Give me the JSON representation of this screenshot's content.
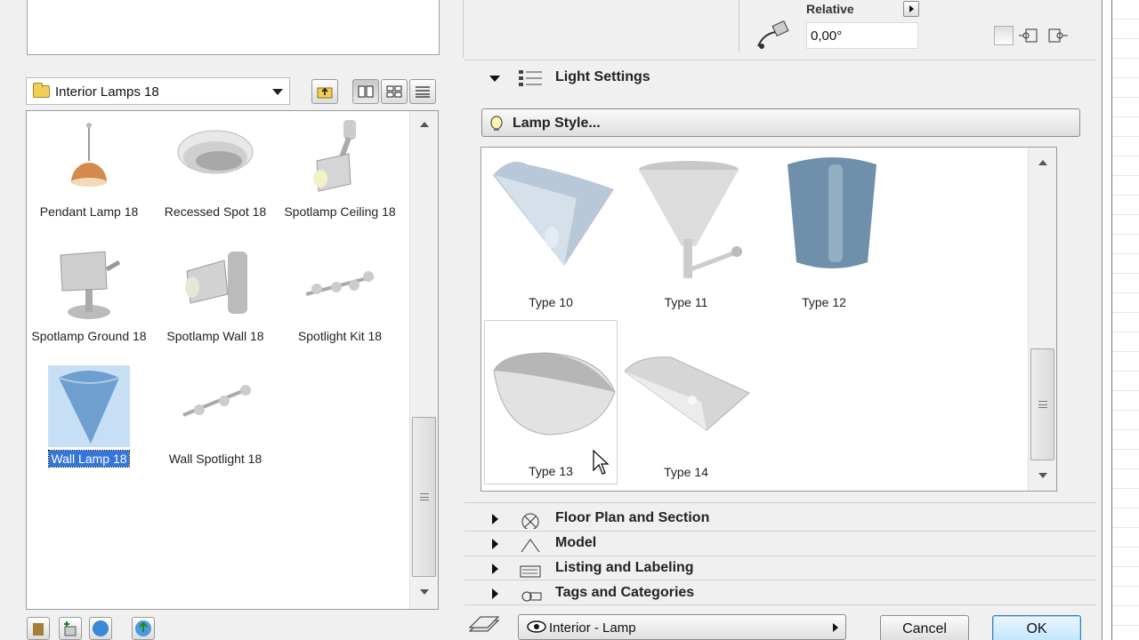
{
  "left_panel": {
    "folder": {
      "name": "Interior Lamps 18"
    },
    "view_buttons": [
      "up-folder-icon",
      "large-icons-icon",
      "small-icons-icon",
      "list-view-icon"
    ],
    "items": [
      {
        "label": "Pendant Lamp 18",
        "icon": "pendant-lamp-icon"
      },
      {
        "label": "Recessed Spot 18",
        "icon": "recessed-spot-icon"
      },
      {
        "label": "Spotlamp Ceiling 18",
        "icon": "spotlamp-ceiling-icon"
      },
      {
        "label": "Spotlamp Ground 18",
        "icon": "spotlamp-ground-icon"
      },
      {
        "label": "Spotlamp Wall 18",
        "icon": "spotlamp-wall-icon"
      },
      {
        "label": "Spotlight Kit 18",
        "icon": "spotlight-kit-icon"
      },
      {
        "label": "Wall Lamp 18",
        "icon": "wall-lamp-icon",
        "selected": true
      },
      {
        "label": "Wall Spotlight 18",
        "icon": "wall-spotlight-icon"
      }
    ]
  },
  "top_right": {
    "relative_label": "Relative",
    "angle_value": "0,00°"
  },
  "sections": {
    "light_settings": "Light Settings",
    "floor_plan": "Floor Plan and Section",
    "model": "Model",
    "listing": "Listing and Labeling",
    "tags": "Tags and Categories"
  },
  "lamp_style_button": "Lamp Style...",
  "lamp_types": [
    {
      "label": "Type 10",
      "icon": "cone-wall-lamp-icon"
    },
    {
      "label": "Type 11",
      "icon": "funnel-lamp-icon"
    },
    {
      "label": "Type 12",
      "icon": "cylinder-lamp-icon"
    },
    {
      "label": "Type 13",
      "icon": "bowl-lamp-icon"
    },
    {
      "label": "Type 14",
      "icon": "dish-lamp-icon"
    }
  ],
  "bottom_bar": {
    "view_select": "Interior - Lamp",
    "cancel": "Cancel",
    "ok": "OK"
  },
  "colors": {
    "selection": "#3377dd",
    "ok_button": "#bee6fd"
  }
}
